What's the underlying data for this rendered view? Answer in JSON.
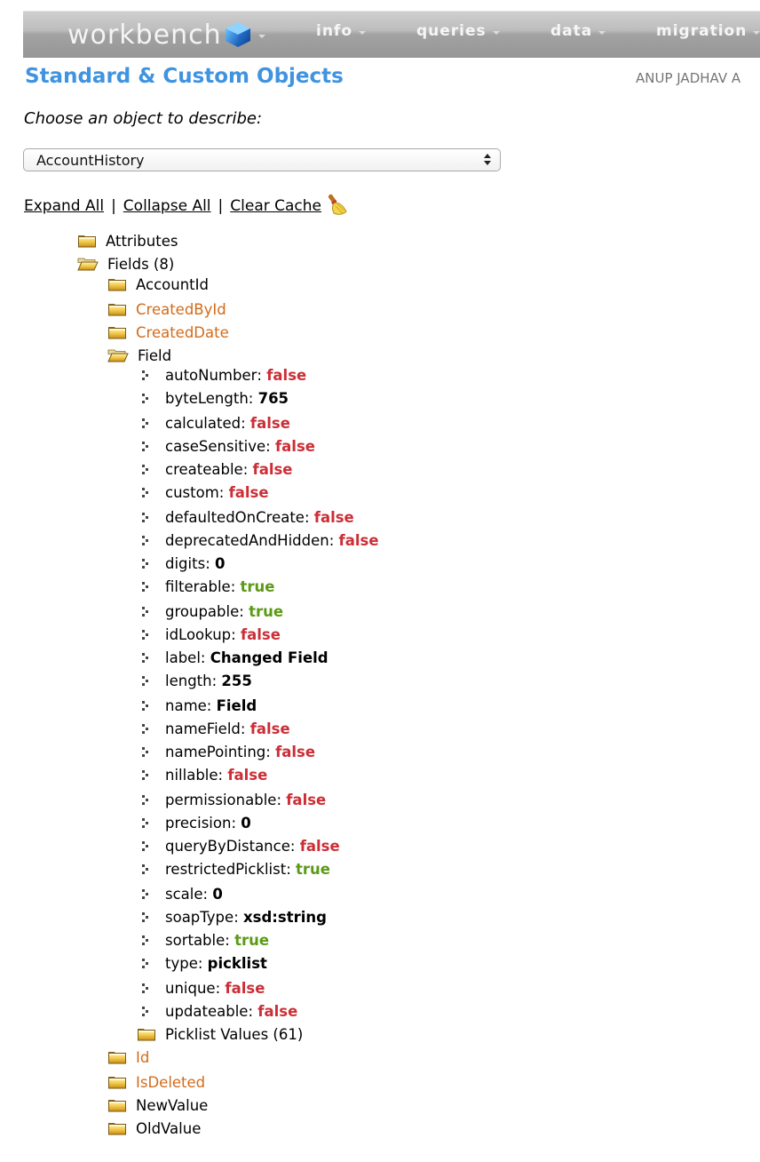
{
  "nav": {
    "brand": "workbench",
    "brand_icon": "cube-icon",
    "menu_items": [
      {
        "label": "info"
      },
      {
        "label": "queries"
      },
      {
        "label": "data"
      },
      {
        "label": "migration"
      }
    ]
  },
  "header": {
    "title": "Standard & Custom Objects",
    "user": "ANUP JADHAV A"
  },
  "chooser": {
    "label": "Choose an object to describe:",
    "selected": "AccountHistory"
  },
  "actions": {
    "expand_all": "Expand All",
    "collapse_all": "Collapse All",
    "clear_cache": "Clear Cache",
    "separator": "|",
    "clear_cache_icon": "broom-icon"
  },
  "colors": {
    "title": "#3f93e0",
    "false_value": "#cc2e36",
    "true_value": "#5c9a16",
    "highlight_field": "#d36b1a"
  },
  "tree": {
    "attributes": "Attributes",
    "fields_label": "Fields (8)",
    "fields": [
      {
        "name": "AccountId",
        "highlight": false
      },
      {
        "name": "CreatedById",
        "highlight": true
      },
      {
        "name": "CreatedDate",
        "highlight": true
      },
      {
        "name": "Field",
        "highlight": false,
        "expanded": true
      },
      {
        "name": "Id",
        "highlight": true
      },
      {
        "name": "IsDeleted",
        "highlight": true
      },
      {
        "name": "NewValue",
        "highlight": false
      },
      {
        "name": "OldValue",
        "highlight": false
      }
    ],
    "field_properties": [
      {
        "key": "autoNumber",
        "value": "false",
        "kind": "false"
      },
      {
        "key": "byteLength",
        "value": "765",
        "kind": "plain"
      },
      {
        "key": "calculated",
        "value": "false",
        "kind": "false"
      },
      {
        "key": "caseSensitive",
        "value": "false",
        "kind": "false"
      },
      {
        "key": "createable",
        "value": "false",
        "kind": "false"
      },
      {
        "key": "custom",
        "value": "false",
        "kind": "false"
      },
      {
        "key": "defaultedOnCreate",
        "value": "false",
        "kind": "false"
      },
      {
        "key": "deprecatedAndHidden",
        "value": "false",
        "kind": "false"
      },
      {
        "key": "digits",
        "value": "0",
        "kind": "plain"
      },
      {
        "key": "filterable",
        "value": "true",
        "kind": "true"
      },
      {
        "key": "groupable",
        "value": "true",
        "kind": "true"
      },
      {
        "key": "idLookup",
        "value": "false",
        "kind": "false"
      },
      {
        "key": "label",
        "value": "Changed Field",
        "kind": "plain"
      },
      {
        "key": "length",
        "value": "255",
        "kind": "plain"
      },
      {
        "key": "name",
        "value": "Field",
        "kind": "plain"
      },
      {
        "key": "nameField",
        "value": "false",
        "kind": "false"
      },
      {
        "key": "namePointing",
        "value": "false",
        "kind": "false"
      },
      {
        "key": "nillable",
        "value": "false",
        "kind": "false"
      },
      {
        "key": "permissionable",
        "value": "false",
        "kind": "false"
      },
      {
        "key": "precision",
        "value": "0",
        "kind": "plain"
      },
      {
        "key": "queryByDistance",
        "value": "false",
        "kind": "false"
      },
      {
        "key": "restrictedPicklist",
        "value": "true",
        "kind": "true"
      },
      {
        "key": "scale",
        "value": "0",
        "kind": "plain"
      },
      {
        "key": "soapType",
        "value": "xsd:string",
        "kind": "plain"
      },
      {
        "key": "sortable",
        "value": "true",
        "kind": "true"
      },
      {
        "key": "type",
        "value": "picklist",
        "kind": "plain"
      },
      {
        "key": "unique",
        "value": "false",
        "kind": "false"
      },
      {
        "key": "updateable",
        "value": "false",
        "kind": "false"
      }
    ],
    "picklist_values": "Picklist Values (61)"
  }
}
